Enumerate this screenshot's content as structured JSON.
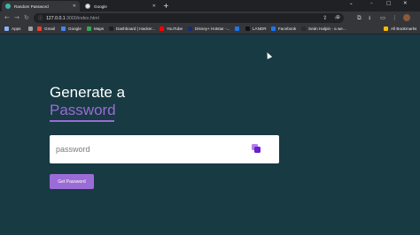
{
  "browser": {
    "tabs": [
      {
        "title": "Random Password",
        "favicon": "password-icon"
      },
      {
        "title": "Google",
        "favicon": "google-icon"
      }
    ],
    "new_tab": "+",
    "window_controls": {
      "minimize": "–",
      "maximize": "□",
      "close": "✕"
    },
    "dropdown": "⌄",
    "url": {
      "host": "127.0.0.1",
      "rest": ":3000/index.html"
    },
    "nav": {
      "back": "←",
      "forward": "→",
      "reload": "↻"
    },
    "toolbar_icons": {
      "share": "⇪",
      "star": "☆",
      "extension": "⧉",
      "download": "⭳",
      "sidepanel": "▭",
      "menu": "⋮"
    }
  },
  "bookmarks": [
    {
      "label": "Apps",
      "color": "#8ab4f8"
    },
    {
      "label": "",
      "color": "#9aa0a6"
    },
    {
      "label": "Gmail",
      "color": "#ea4335"
    },
    {
      "label": "Google",
      "color": "#4285f4"
    },
    {
      "label": "Maps",
      "color": "#34a853"
    },
    {
      "label": "Dashboard | Hacker...",
      "color": "#1f1f1f"
    },
    {
      "label": "YouTube",
      "color": "#ff0000"
    },
    {
      "label": "Disney+ Hotstar -...",
      "color": "#1a2a6c"
    },
    {
      "label": "",
      "color": "#1877f2"
    },
    {
      "label": "LANDR",
      "color": "#111111"
    },
    {
      "label": "Facebook",
      "color": "#1877f2"
    },
    {
      "label": "Seán Halpin - a we...",
      "color": "#2b2b2b"
    },
    {
      "label": "All Bookmarks",
      "color": "#fbbc04"
    }
  ],
  "page": {
    "heading_line1": "Generate a",
    "heading_line2": "Password",
    "password_placeholder": "password",
    "button_label": "Get Password",
    "accent": "#9b6bd6",
    "background": "#173a43"
  }
}
